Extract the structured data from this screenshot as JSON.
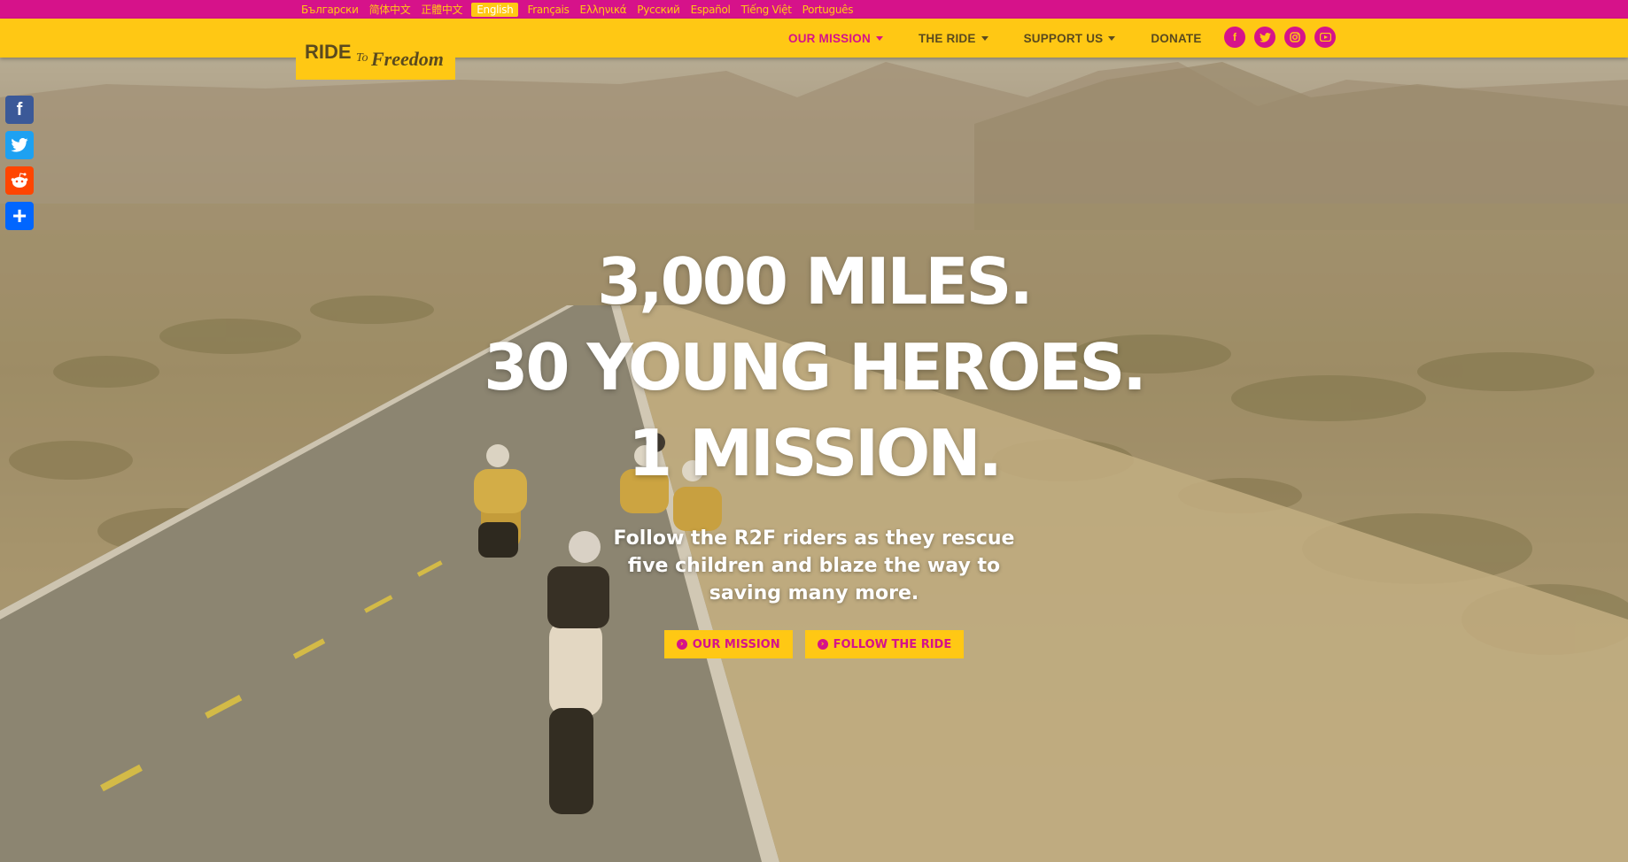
{
  "languages": [
    {
      "label": "Български"
    },
    {
      "label": "简体中文"
    },
    {
      "label": "正體中文"
    },
    {
      "label": "English",
      "active": true
    },
    {
      "label": "Français"
    },
    {
      "label": "Ελληνικά"
    },
    {
      "label": "Русский"
    },
    {
      "label": "Español"
    },
    {
      "label": "Tiếng Việt"
    },
    {
      "label": "Português"
    }
  ],
  "logo": {
    "text_main": "RIDE",
    "text_to": "To",
    "text_script": "Freedom"
  },
  "nav": {
    "items": [
      {
        "label": "OUR MISSION",
        "dropdown": true,
        "active": true
      },
      {
        "label": "THE RIDE",
        "dropdown": true
      },
      {
        "label": "SUPPORT US",
        "dropdown": true
      },
      {
        "label": "DONATE",
        "dropdown": false
      }
    ]
  },
  "social_icons": [
    "facebook-icon",
    "twitter-icon",
    "instagram-icon",
    "youtube-icon"
  ],
  "share_icons": [
    "facebook-icon",
    "twitter-icon",
    "reddit-icon",
    "add-share-icon"
  ],
  "hero": {
    "headline": [
      "3,000 MILES.",
      "30 YOUNG HEROES.",
      "1 MISSION."
    ],
    "subtitle": [
      "Follow the R2F riders as they rescue",
      "five children and blaze the way to",
      "saving many more."
    ],
    "buttons": [
      {
        "label": "OUR MISSION"
      },
      {
        "label": "FOLLOW THE RIDE"
      }
    ]
  },
  "colors": {
    "brand_yellow": "#ffc814",
    "brand_magenta": "#d6128a",
    "nav_text": "#5a4a1e"
  }
}
